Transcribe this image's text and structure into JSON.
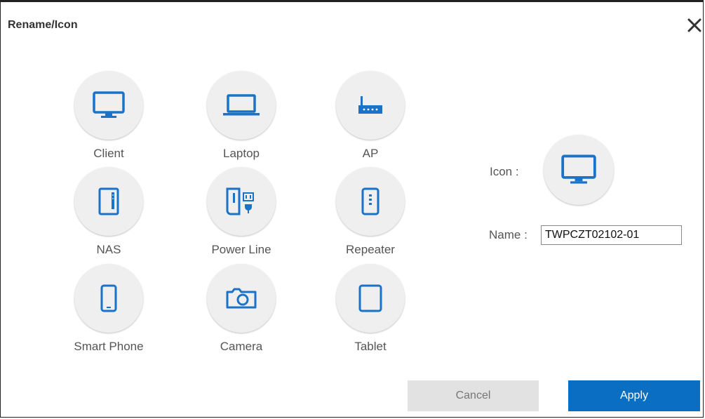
{
  "dialog": {
    "title": "Rename/Icon"
  },
  "icons": [
    {
      "label": "Client",
      "icon": "monitor-icon"
    },
    {
      "label": "Laptop",
      "icon": "laptop-icon"
    },
    {
      "label": "AP",
      "icon": "router-icon"
    },
    {
      "label": "NAS",
      "icon": "nas-icon"
    },
    {
      "label": "Power Line",
      "icon": "power-line-icon"
    },
    {
      "label": "Repeater",
      "icon": "repeater-icon"
    },
    {
      "label": "Smart Phone",
      "icon": "smartphone-icon"
    },
    {
      "label": "Camera",
      "icon": "camera-icon"
    },
    {
      "label": "Tablet",
      "icon": "tablet-icon"
    }
  ],
  "form": {
    "icon_label": "Icon :",
    "selected_icon": "monitor-icon",
    "name_label": "Name :",
    "name_value": "TWPCZT02102-01"
  },
  "buttons": {
    "cancel": "Cancel",
    "apply": "Apply"
  },
  "colors": {
    "accent": "#0a6fc2",
    "icon": "#1a73c8",
    "circle": "#efefef",
    "cancel_bg": "#e2e2e2"
  }
}
